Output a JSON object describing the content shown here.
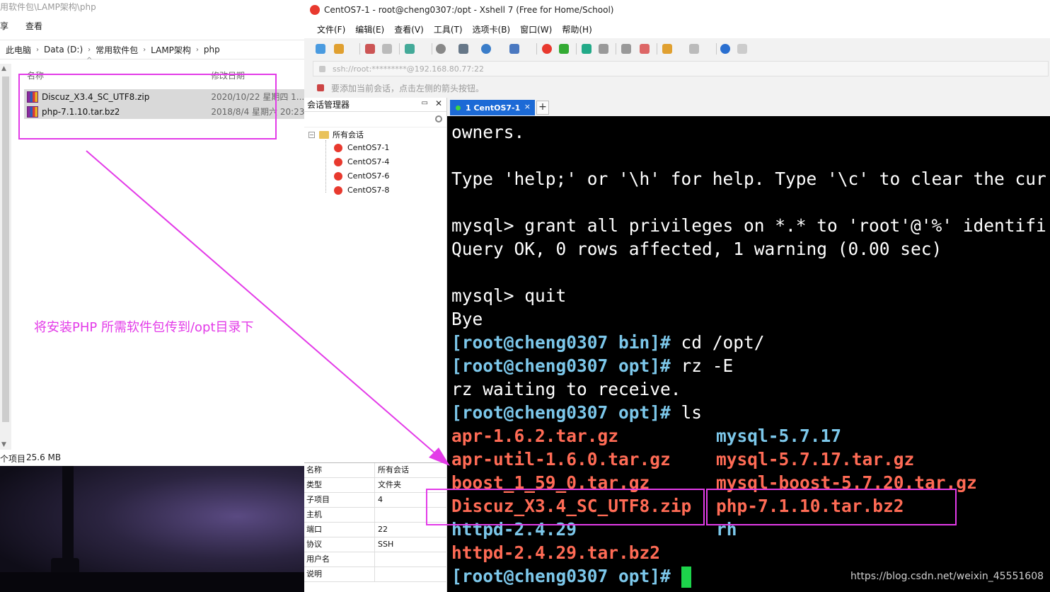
{
  "explorer": {
    "title_path": "用软件包\\LAMP架构\\php",
    "ribbon": {
      "share": "享",
      "view": "查看"
    },
    "breadcrumb": [
      "此电脑",
      "Data (D:)",
      "常用软件包",
      "LAMP架构",
      "php"
    ],
    "columns": {
      "name": "名称",
      "modified": "修改日期"
    },
    "files": [
      {
        "name": "Discuz_X3.4_SC_UTF8.zip",
        "date": "2020/10/22 星期四 1..."
      },
      {
        "name": "php-7.1.10.tar.bz2",
        "date": "2018/8/4 星期六 20:23"
      }
    ],
    "status": {
      "items": "个项目",
      "size": "25.6 MB"
    }
  },
  "annotation": {
    "note": "将安装PHP 所需软件包传到/opt目录下",
    "color": "#e33be8"
  },
  "xshell": {
    "title": "CentOS7-1 - root@cheng0307:/opt - Xshell 7 (Free for Home/School)",
    "menu": [
      "文件(F)",
      "编辑(E)",
      "查看(V)",
      "工具(T)",
      "选项卡(B)",
      "窗口(W)",
      "帮助(H)"
    ],
    "address": "ssh://root:*********@192.168.80.77:22",
    "hint": "要添加当前会话，点击左侧的箭头按钮。",
    "session_manager": {
      "title": "会话管理器",
      "pin": "ᵖ",
      "root": "所有会话",
      "sessions": [
        "CentOS7-1",
        "CentOS7-4",
        "CentOS7-6",
        "CentOS7-8"
      ]
    },
    "properties": [
      {
        "k": "名称",
        "v": "所有会话"
      },
      {
        "k": "类型",
        "v": "文件夹"
      },
      {
        "k": "子项目",
        "v": "4"
      },
      {
        "k": "主机",
        "v": ""
      },
      {
        "k": "端口",
        "v": "22"
      },
      {
        "k": "协议",
        "v": "SSH"
      },
      {
        "k": "用户名",
        "v": ""
      },
      {
        "k": "说明",
        "v": ""
      }
    ],
    "tab": {
      "label": "1 CentOS7-1",
      "add": "+",
      "close": "×"
    },
    "terminal": {
      "l1": "owners.",
      "l2": "Type 'help;' or '\\h' for help. Type '\\c' to clear the cur",
      "l3_prompt": "mysql> ",
      "l3_cmd": "grant all privileges on *.* to 'root'@'%' identifi",
      "l4": "Query OK, 0 rows affected, 1 warning (0.00 sec)",
      "l5_prompt": "mysql> ",
      "l5_cmd": "quit",
      "l6": "Bye",
      "prompt_bin": "[root@cheng0307 bin]#",
      "cmd_cd": " cd /opt/",
      "prompt_opt": "[root@cheng0307 opt]#",
      "cmd_rz": " rz -E",
      "rz_wait": "rz waiting to receive.",
      "cmd_ls": " ls",
      "ls_left": [
        "apr-1.6.2.tar.gz",
        "apr-util-1.6.0.tar.gz",
        "boost_1_59_0.tar.gz",
        "Discuz_X3.4_SC_UTF8.zip",
        "httpd-2.4.29",
        "httpd-2.4.29.tar.bz2"
      ],
      "ls_right": [
        "mysql-5.7.17",
        "mysql-5.7.17.tar.gz",
        "mysql-boost-5.7.20.tar.gz",
        "php-7.1.10.tar.bz2",
        "rh"
      ]
    }
  },
  "watermark": "https://blog.csdn.net/weixin_45551608"
}
